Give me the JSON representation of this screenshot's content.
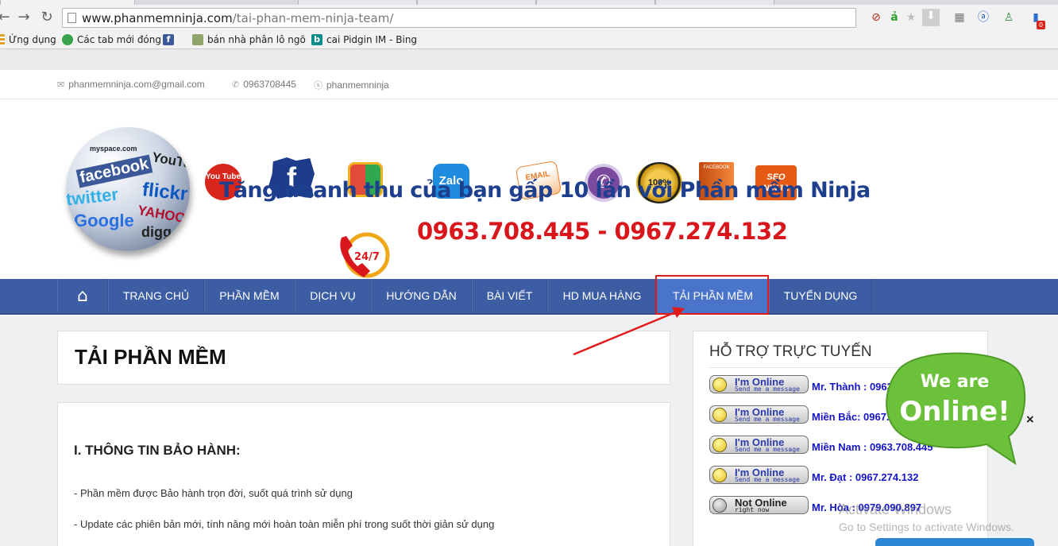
{
  "browser": {
    "url_domain": "www.phanmemninja.com",
    "url_path": "/tai-phan-mem-ninja-team/",
    "bookmarks": [
      {
        "label": "Ứng dụng",
        "icon": "apps-icon"
      },
      {
        "label": "Các tab mới đóng",
        "icon": "recent-tabs-icon"
      },
      {
        "label": "",
        "icon": "facebook-icon"
      },
      {
        "label": "bán nhà phân lô ngõ",
        "icon": "building-icon"
      },
      {
        "label": "cai Pidgin IM - Bing",
        "icon": "bing-icon"
      }
    ],
    "extension_badge": "0"
  },
  "topbar": {
    "email": "phanmemninja.com@gmail.com",
    "phone": "0963708445",
    "skype": "phanmemninja"
  },
  "banner": {
    "slogan": "Tăng doanh thu của bạn gấp 10 lần với Phần mềm Ninja",
    "phones": "0963.708.445  - 0967.274.132",
    "phone_badge": "24/7",
    "globe_words": [
      "facebook",
      "twitter",
      "flickr",
      "Google",
      "YAHOO",
      "myspace.com",
      "YouTube",
      "digg"
    ],
    "icons": [
      {
        "name": "youtube-icon",
        "label": "You Tube",
        "color": "#d8261c"
      },
      {
        "name": "facebook-icon",
        "label": "f",
        "color": "#1d3c8c"
      },
      {
        "name": "google-icon",
        "label": "",
        "color": "#2fa84f"
      },
      {
        "name": "zalo-icon",
        "label": "Zalo",
        "color": "#1f8ce0"
      },
      {
        "name": "email-icon",
        "label": "EMAIL",
        "color": "#f07a22"
      },
      {
        "name": "viber-icon",
        "label": "",
        "color": "#7b4a9e"
      },
      {
        "name": "money-back-icon",
        "label": "100%",
        "color": "#d9a514"
      },
      {
        "name": "facebook-box-icon",
        "label": "FACEBOOK",
        "color": "#e8611a"
      },
      {
        "name": "seo-ninja-icon",
        "label": "SEO NINJA",
        "color": "#e65a15"
      }
    ]
  },
  "nav": {
    "items": [
      "TRANG CHỦ",
      "PHẦN MỀM",
      "DỊCH VỤ",
      "HƯỚNG DẪN",
      "BÀI VIẾT",
      "HD MUA HÀNG",
      "TẢI PHẦN MỀM",
      "TUYỂN DỤNG"
    ],
    "active": "TẢI PHẦN MỀM"
  },
  "main": {
    "title": "TẢI PHẦN MỀM",
    "section_heading": "I. THÔNG TIN BẢO HÀNH:",
    "paragraphs": [
      "- Phần mềm được Bảo hành trọn đời, suốt quá trình sử dụng",
      "- Update các phiên bản mới, tính năng mới hoàn toàn miễn phí trong suốt thời giản sử dụng"
    ]
  },
  "support": {
    "title": "HỖ TRỢ TRỰC TUYẾN",
    "rows": [
      {
        "status": "I'm Online",
        "sub": "Send me a message",
        "text": "Mr. Thành : 0963.708.445"
      },
      {
        "status": "I'm Online",
        "sub": "Send me a message",
        "text": "Miền Bắc: 0967.274.132"
      },
      {
        "status": "I'm Online",
        "sub": "Send me a message",
        "text": "Miền Nam : 0963.708.445"
      },
      {
        "status": "I'm Online",
        "sub": "Send me a message",
        "text": "Mr. Đạt : 0967.274.132"
      },
      {
        "status": "Not Online",
        "sub": "right now",
        "text": "Mr. Hòa : 0979.090.897"
      }
    ]
  },
  "widget": {
    "line1": "We are",
    "line2": "Online!",
    "close": "×"
  },
  "os": {
    "watermark_line1": "Activate Windows",
    "watermark_line2": "Go to Settings to activate Windows."
  },
  "colors": {
    "nav_bg": "#3c5da4",
    "nav_active": "#4a74c9",
    "annotation_red": "#e01b1b",
    "phone_red": "#d8161b",
    "slogan_blue": "#1d3f8e",
    "support_link": "#1515c8",
    "bubble_green": "#6cc13a"
  }
}
